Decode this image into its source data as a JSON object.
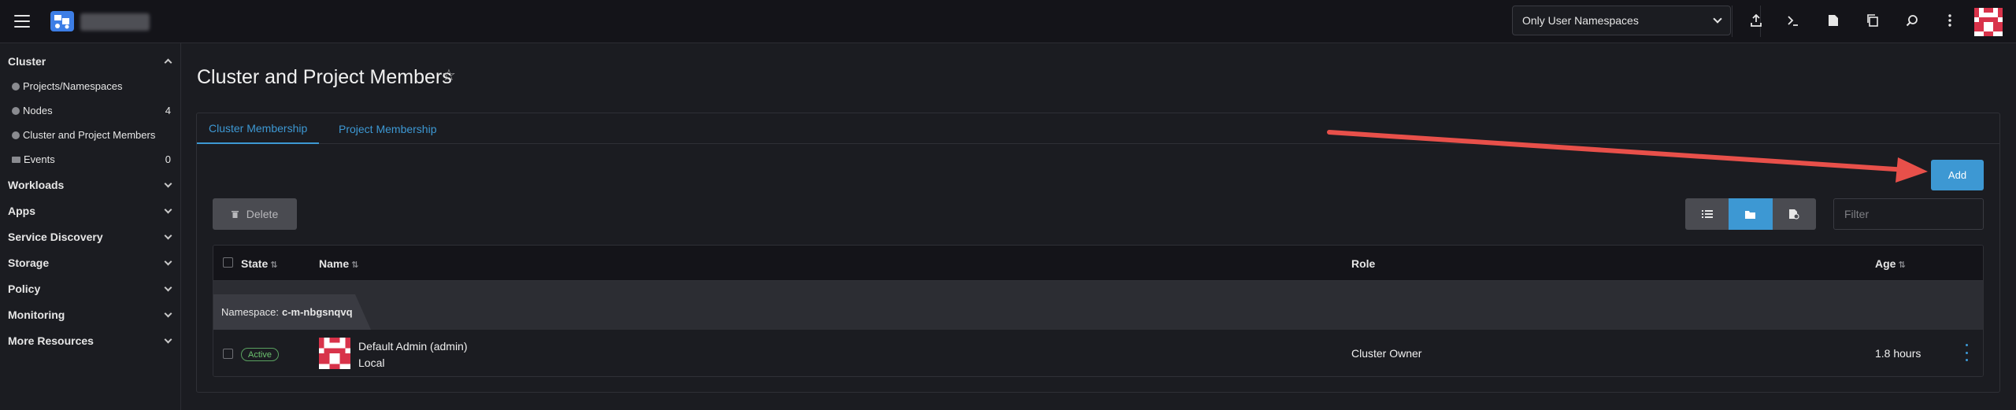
{
  "header": {
    "namespace_filter": "Only User Namespaces",
    "icons": [
      "import-yaml-icon",
      "kubectl-shell-icon",
      "download-kubeconfig-icon",
      "copy-kubeconfig-icon",
      "search-icon",
      "more-icon"
    ]
  },
  "sidebar": {
    "groups": [
      {
        "label": "Cluster",
        "expanded": true
      },
      {
        "label": "Workloads"
      },
      {
        "label": "Apps"
      },
      {
        "label": "Service Discovery"
      },
      {
        "label": "Storage"
      },
      {
        "label": "Policy"
      },
      {
        "label": "Monitoring"
      },
      {
        "label": "More Resources"
      }
    ],
    "cluster_items": [
      {
        "label": "Projects/Namespaces",
        "count": ""
      },
      {
        "label": "Nodes",
        "count": "4"
      },
      {
        "label": "Cluster and Project Members",
        "count": ""
      },
      {
        "label": "Events",
        "count": "0"
      }
    ]
  },
  "page": {
    "title": "Cluster and Project Members",
    "tabs": [
      "Cluster Membership",
      "Project Membership"
    ],
    "add_label": "Add",
    "delete_label": "Delete",
    "filter_placeholder": "Filter"
  },
  "table": {
    "columns": {
      "state": "State",
      "name": "Name",
      "role": "Role",
      "age": "Age"
    },
    "group": {
      "prefix": "Namespace:",
      "name": "c-m-nbgsnqvq"
    },
    "rows": [
      {
        "state": "Active",
        "name": "Default Admin (admin)",
        "provider": "Local",
        "role": "Cluster Owner",
        "age": "1.8 hours"
      }
    ]
  },
  "colors": {
    "accent": "#3d98d3",
    "annotation_arrow": "#e8504a",
    "active_badge": "#6cc26f"
  }
}
